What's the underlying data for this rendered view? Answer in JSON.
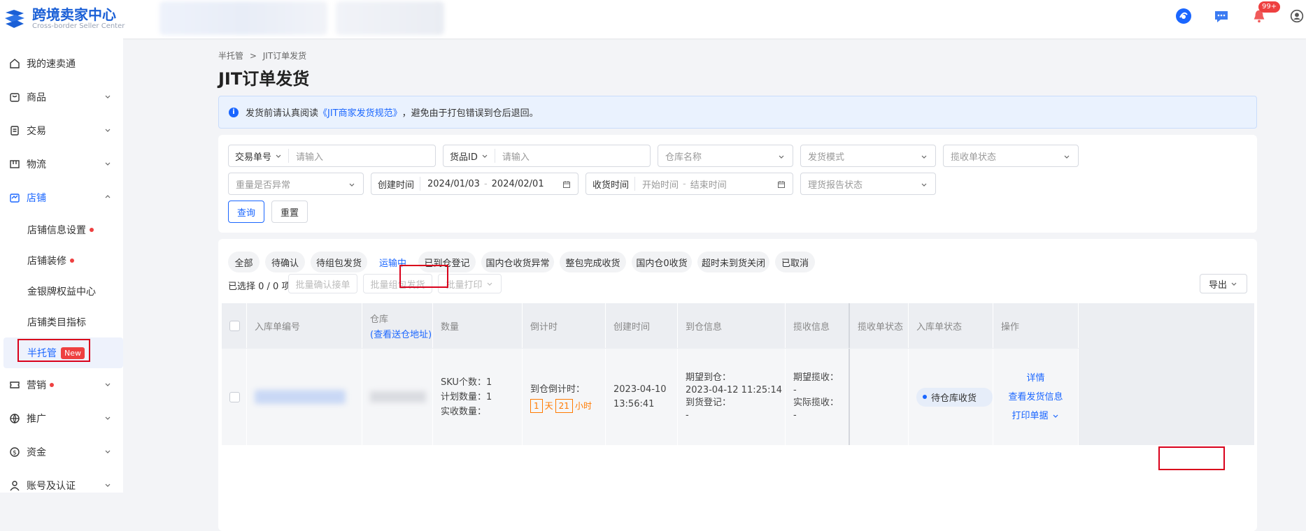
{
  "app": {
    "title": "跨境卖家中心",
    "subtitle": "Cross-border Seller Center",
    "notification_count": "99+"
  },
  "sidebar": {
    "items": [
      {
        "label": "我的速卖通"
      },
      {
        "label": "商品"
      },
      {
        "label": "交易"
      },
      {
        "label": "物流"
      },
      {
        "label": "店铺"
      },
      {
        "label": "营销"
      },
      {
        "label": "推广"
      },
      {
        "label": "资金"
      },
      {
        "label": "账号及认证"
      }
    ],
    "store_sub": [
      {
        "label": "店铺信息设置"
      },
      {
        "label": "店铺装修"
      },
      {
        "label": "金银牌权益中心"
      },
      {
        "label": "店铺类目指标"
      },
      {
        "label": "半托管"
      }
    ],
    "new_tag": "New"
  },
  "breadcrumb": {
    "parent": "半托管",
    "sep": ">",
    "current": "JIT订单发货"
  },
  "page_title": "JIT订单发货",
  "notice": {
    "before": "发货前请认真阅读",
    "link": "《JIT商家发货规范》",
    "after": "，避免由于打包错误到仓后退回。"
  },
  "filters": {
    "trade_no_label": "交易单号",
    "trade_no_placeholder": "请输入",
    "goods_id_label": "货品ID",
    "goods_id_placeholder": "请输入",
    "warehouse_placeholder": "仓库名称",
    "ship_mode_placeholder": "发货模式",
    "pickup_status_placeholder": "揽收单状态",
    "weight_placeholder": "重量是否异常",
    "created_label": "创建时间",
    "created_start": "2024/01/03",
    "created_end": "2024/02/01",
    "received_label": "收货时间",
    "received_start_placeholder": "开始时间",
    "received_end_placeholder": "结束时间",
    "report_status_placeholder": "理货报告状态",
    "search_btn": "查询",
    "reset_btn": "重置",
    "range_sep": "-"
  },
  "tabs": [
    "全部",
    "待确认",
    "待组包发货",
    "运输中",
    "已到仓登记",
    "国内仓收货异常",
    "整包完成收货",
    "国内仓0收货",
    "超时未到货关闭",
    "已取消"
  ],
  "toolbar": {
    "selected": "已选择 0 / 0 项",
    "batch_confirm": "批量确认接单",
    "batch_pack": "批量组包发货",
    "batch_print": "批量打印",
    "export": "导出"
  },
  "table": {
    "headers": {
      "order_no": "入库单编号",
      "warehouse": "仓库",
      "warehouse_link": "(查看送仓地址)",
      "quantity": "数量",
      "countdown": "倒计时",
      "created": "创建时间",
      "arrival": "到仓信息",
      "pickup": "揽收信息",
      "pickup_status": "揽收单状态",
      "inbound_status": "入库单状态",
      "ops": "操作"
    },
    "row": {
      "sku_count": "SKU个数：1",
      "plan_qty": "计划数量：1",
      "actual_qty": "实收数量：",
      "countdown_label": "到仓倒计时：",
      "cd_days": "1",
      "cd_day_unit": "天",
      "cd_hours": "21",
      "cd_hour_unit": "小时",
      "created_date": "2023-04-10",
      "created_time": "13:56:41",
      "expect_arrive_label": "期望到仓：",
      "expect_arrive": "2023-04-12 11:25:14",
      "arrive_reg_label": "到货登记：",
      "arrive_reg": "-",
      "expect_pickup_label": "期望揽收：",
      "expect_pickup": "-",
      "actual_pickup_label": "实际揽收：",
      "actual_pickup": "-",
      "status": "待仓库收货",
      "op_detail": "详情",
      "op_ship_info": "查看发货信息",
      "op_print": "打印单据"
    }
  }
}
